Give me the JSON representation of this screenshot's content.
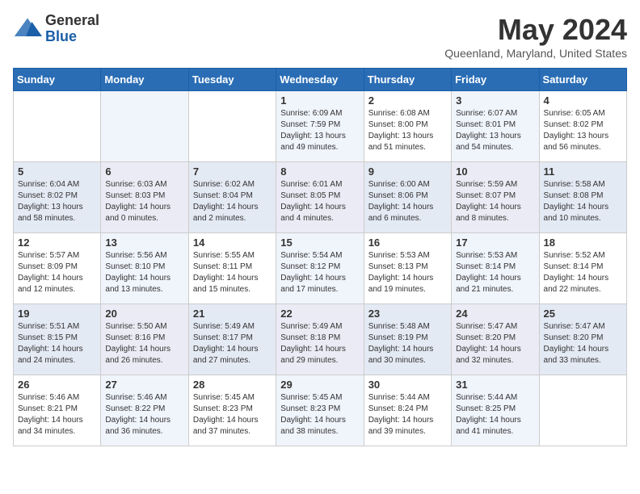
{
  "header": {
    "logo_general": "General",
    "logo_blue": "Blue",
    "month_title": "May 2024",
    "location": "Queenland, Maryland, United States"
  },
  "days_of_week": [
    "Sunday",
    "Monday",
    "Tuesday",
    "Wednesday",
    "Thursday",
    "Friday",
    "Saturday"
  ],
  "weeks": [
    [
      {
        "day": "",
        "sunrise": "",
        "sunset": "",
        "daylight": ""
      },
      {
        "day": "",
        "sunrise": "",
        "sunset": "",
        "daylight": ""
      },
      {
        "day": "",
        "sunrise": "",
        "sunset": "",
        "daylight": ""
      },
      {
        "day": "1",
        "sunrise": "Sunrise: 6:09 AM",
        "sunset": "Sunset: 7:59 PM",
        "daylight": "Daylight: 13 hours and 49 minutes."
      },
      {
        "day": "2",
        "sunrise": "Sunrise: 6:08 AM",
        "sunset": "Sunset: 8:00 PM",
        "daylight": "Daylight: 13 hours and 51 minutes."
      },
      {
        "day": "3",
        "sunrise": "Sunrise: 6:07 AM",
        "sunset": "Sunset: 8:01 PM",
        "daylight": "Daylight: 13 hours and 54 minutes."
      },
      {
        "day": "4",
        "sunrise": "Sunrise: 6:05 AM",
        "sunset": "Sunset: 8:02 PM",
        "daylight": "Daylight: 13 hours and 56 minutes."
      }
    ],
    [
      {
        "day": "5",
        "sunrise": "Sunrise: 6:04 AM",
        "sunset": "Sunset: 8:02 PM",
        "daylight": "Daylight: 13 hours and 58 minutes."
      },
      {
        "day": "6",
        "sunrise": "Sunrise: 6:03 AM",
        "sunset": "Sunset: 8:03 PM",
        "daylight": "Daylight: 14 hours and 0 minutes."
      },
      {
        "day": "7",
        "sunrise": "Sunrise: 6:02 AM",
        "sunset": "Sunset: 8:04 PM",
        "daylight": "Daylight: 14 hours and 2 minutes."
      },
      {
        "day": "8",
        "sunrise": "Sunrise: 6:01 AM",
        "sunset": "Sunset: 8:05 PM",
        "daylight": "Daylight: 14 hours and 4 minutes."
      },
      {
        "day": "9",
        "sunrise": "Sunrise: 6:00 AM",
        "sunset": "Sunset: 8:06 PM",
        "daylight": "Daylight: 14 hours and 6 minutes."
      },
      {
        "day": "10",
        "sunrise": "Sunrise: 5:59 AM",
        "sunset": "Sunset: 8:07 PM",
        "daylight": "Daylight: 14 hours and 8 minutes."
      },
      {
        "day": "11",
        "sunrise": "Sunrise: 5:58 AM",
        "sunset": "Sunset: 8:08 PM",
        "daylight": "Daylight: 14 hours and 10 minutes."
      }
    ],
    [
      {
        "day": "12",
        "sunrise": "Sunrise: 5:57 AM",
        "sunset": "Sunset: 8:09 PM",
        "daylight": "Daylight: 14 hours and 12 minutes."
      },
      {
        "day": "13",
        "sunrise": "Sunrise: 5:56 AM",
        "sunset": "Sunset: 8:10 PM",
        "daylight": "Daylight: 14 hours and 13 minutes."
      },
      {
        "day": "14",
        "sunrise": "Sunrise: 5:55 AM",
        "sunset": "Sunset: 8:11 PM",
        "daylight": "Daylight: 14 hours and 15 minutes."
      },
      {
        "day": "15",
        "sunrise": "Sunrise: 5:54 AM",
        "sunset": "Sunset: 8:12 PM",
        "daylight": "Daylight: 14 hours and 17 minutes."
      },
      {
        "day": "16",
        "sunrise": "Sunrise: 5:53 AM",
        "sunset": "Sunset: 8:13 PM",
        "daylight": "Daylight: 14 hours and 19 minutes."
      },
      {
        "day": "17",
        "sunrise": "Sunrise: 5:53 AM",
        "sunset": "Sunset: 8:14 PM",
        "daylight": "Daylight: 14 hours and 21 minutes."
      },
      {
        "day": "18",
        "sunrise": "Sunrise: 5:52 AM",
        "sunset": "Sunset: 8:14 PM",
        "daylight": "Daylight: 14 hours and 22 minutes."
      }
    ],
    [
      {
        "day": "19",
        "sunrise": "Sunrise: 5:51 AM",
        "sunset": "Sunset: 8:15 PM",
        "daylight": "Daylight: 14 hours and 24 minutes."
      },
      {
        "day": "20",
        "sunrise": "Sunrise: 5:50 AM",
        "sunset": "Sunset: 8:16 PM",
        "daylight": "Daylight: 14 hours and 26 minutes."
      },
      {
        "day": "21",
        "sunrise": "Sunrise: 5:49 AM",
        "sunset": "Sunset: 8:17 PM",
        "daylight": "Daylight: 14 hours and 27 minutes."
      },
      {
        "day": "22",
        "sunrise": "Sunrise: 5:49 AM",
        "sunset": "Sunset: 8:18 PM",
        "daylight": "Daylight: 14 hours and 29 minutes."
      },
      {
        "day": "23",
        "sunrise": "Sunrise: 5:48 AM",
        "sunset": "Sunset: 8:19 PM",
        "daylight": "Daylight: 14 hours and 30 minutes."
      },
      {
        "day": "24",
        "sunrise": "Sunrise: 5:47 AM",
        "sunset": "Sunset: 8:20 PM",
        "daylight": "Daylight: 14 hours and 32 minutes."
      },
      {
        "day": "25",
        "sunrise": "Sunrise: 5:47 AM",
        "sunset": "Sunset: 8:20 PM",
        "daylight": "Daylight: 14 hours and 33 minutes."
      }
    ],
    [
      {
        "day": "26",
        "sunrise": "Sunrise: 5:46 AM",
        "sunset": "Sunset: 8:21 PM",
        "daylight": "Daylight: 14 hours and 34 minutes."
      },
      {
        "day": "27",
        "sunrise": "Sunrise: 5:46 AM",
        "sunset": "Sunset: 8:22 PM",
        "daylight": "Daylight: 14 hours and 36 minutes."
      },
      {
        "day": "28",
        "sunrise": "Sunrise: 5:45 AM",
        "sunset": "Sunset: 8:23 PM",
        "daylight": "Daylight: 14 hours and 37 minutes."
      },
      {
        "day": "29",
        "sunrise": "Sunrise: 5:45 AM",
        "sunset": "Sunset: 8:23 PM",
        "daylight": "Daylight: 14 hours and 38 minutes."
      },
      {
        "day": "30",
        "sunrise": "Sunrise: 5:44 AM",
        "sunset": "Sunset: 8:24 PM",
        "daylight": "Daylight: 14 hours and 39 minutes."
      },
      {
        "day": "31",
        "sunrise": "Sunrise: 5:44 AM",
        "sunset": "Sunset: 8:25 PM",
        "daylight": "Daylight: 14 hours and 41 minutes."
      },
      {
        "day": "",
        "sunrise": "",
        "sunset": "",
        "daylight": ""
      }
    ]
  ]
}
